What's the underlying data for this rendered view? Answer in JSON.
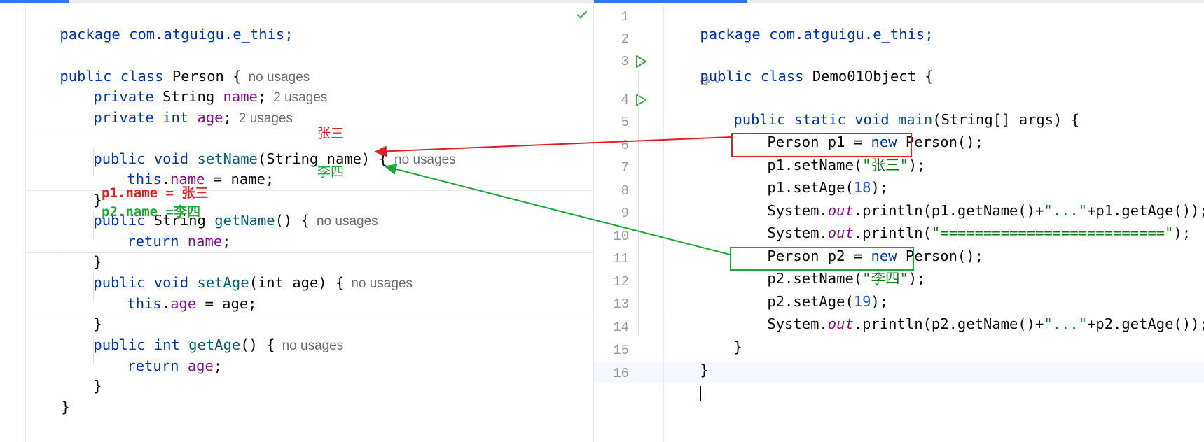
{
  "left_editor": {
    "lines": {
      "package": "package com.atguigu.e_this;",
      "class_decl": {
        "kw1": "public",
        "kw2": "class",
        "name": "Person {",
        "hint": "no usages"
      },
      "field_name": {
        "kw": "private",
        "type": "String",
        "field": "name",
        "semi": ";",
        "hint": "2 usages"
      },
      "field_age": {
        "kw": "private",
        "type": "int",
        "field": "age",
        "semi": ";",
        "hint": "2 usages"
      },
      "set_name": {
        "kw": "public",
        "type": "void",
        "method": "setName",
        "params": "(String name) {",
        "hint": "no usages"
      },
      "set_name_body": {
        "this": "this",
        "field": "name",
        "rest": " = name;"
      },
      "close1": "}",
      "get_name": {
        "kw": "public",
        "type": "String",
        "method": "getName",
        "params": "() {",
        "hint": "no usages"
      },
      "get_name_body": {
        "kw": "return",
        "field": "name",
        "semi": ";"
      },
      "close2": "}",
      "set_age": {
        "kw": "public",
        "type": "void",
        "method": "setAge",
        "params": "(int age) {",
        "hint": "no usages"
      },
      "set_age_body": {
        "this": "this",
        "field": "age",
        "rest": " = age;"
      },
      "close3": "}",
      "get_age": {
        "kw": "public",
        "type": "int",
        "method": "getAge",
        "params": "() {",
        "hint": "no usages"
      },
      "get_age_body": {
        "kw": "return",
        "field": "age",
        "semi": ";"
      },
      "close4": "}",
      "close_class": "}"
    }
  },
  "right_editor": {
    "line_numbers": [
      "1",
      "2",
      "3",
      "4",
      "5",
      "6",
      "7",
      "8",
      "9",
      "10",
      "11",
      "12",
      "13",
      "14",
      "15",
      "16"
    ],
    "lines": {
      "package": "package com.atguigu.e_this;",
      "class_decl": {
        "kw1": "public",
        "kw2": "class",
        "name": "Demo01Object {"
      },
      "main_decl": {
        "kw1": "public",
        "kw2": "static",
        "type": "void",
        "method": "main",
        "params": "(String[] args) {"
      },
      "l5": {
        "pre": "Person p1 = ",
        "kw": "new",
        "post": " Person();"
      },
      "l6": {
        "pre": "p1.setName(",
        "str": "\"张三\"",
        "post": ");"
      },
      "l7": {
        "pre": "p1.setAge(",
        "num": "18",
        "post": ");"
      },
      "l8": {
        "pre": "System.",
        "stat": "out",
        "mid": ".println(p1.getName()+",
        "str": "\"...\"",
        "post": "+p1.getAge());"
      },
      "l9": {
        "pre": "System.",
        "stat": "out",
        "mid": ".println(",
        "str": "\"==========================\"",
        "post": ");"
      },
      "l10": {
        "pre": "Person p2 = ",
        "kw": "new",
        "post": " Person();"
      },
      "l11": {
        "pre": "p2.setName(",
        "str": "\"李四\"",
        "post": ");"
      },
      "l12": {
        "pre": "p2.setAge(",
        "num": "19",
        "post": ");"
      },
      "l13": {
        "pre": "System.",
        "stat": "out",
        "mid": ".println(p2.getName()+",
        "str": "\"...\"",
        "post": "+p2.getAge());"
      },
      "l14": "}",
      "l15": "}"
    }
  },
  "annotations": {
    "zhangsan_label": "张三",
    "lisi_label": "李四",
    "p1_name": "p1.name = 张三",
    "p2_name": "p2.name =李四"
  },
  "colors": {
    "keyword": "#0033b3",
    "field": "#871094",
    "method": "#00627a",
    "string": "#067d17",
    "number": "#1750eb",
    "annotation_red": "#e02020",
    "annotation_green": "#1aaa3a"
  }
}
